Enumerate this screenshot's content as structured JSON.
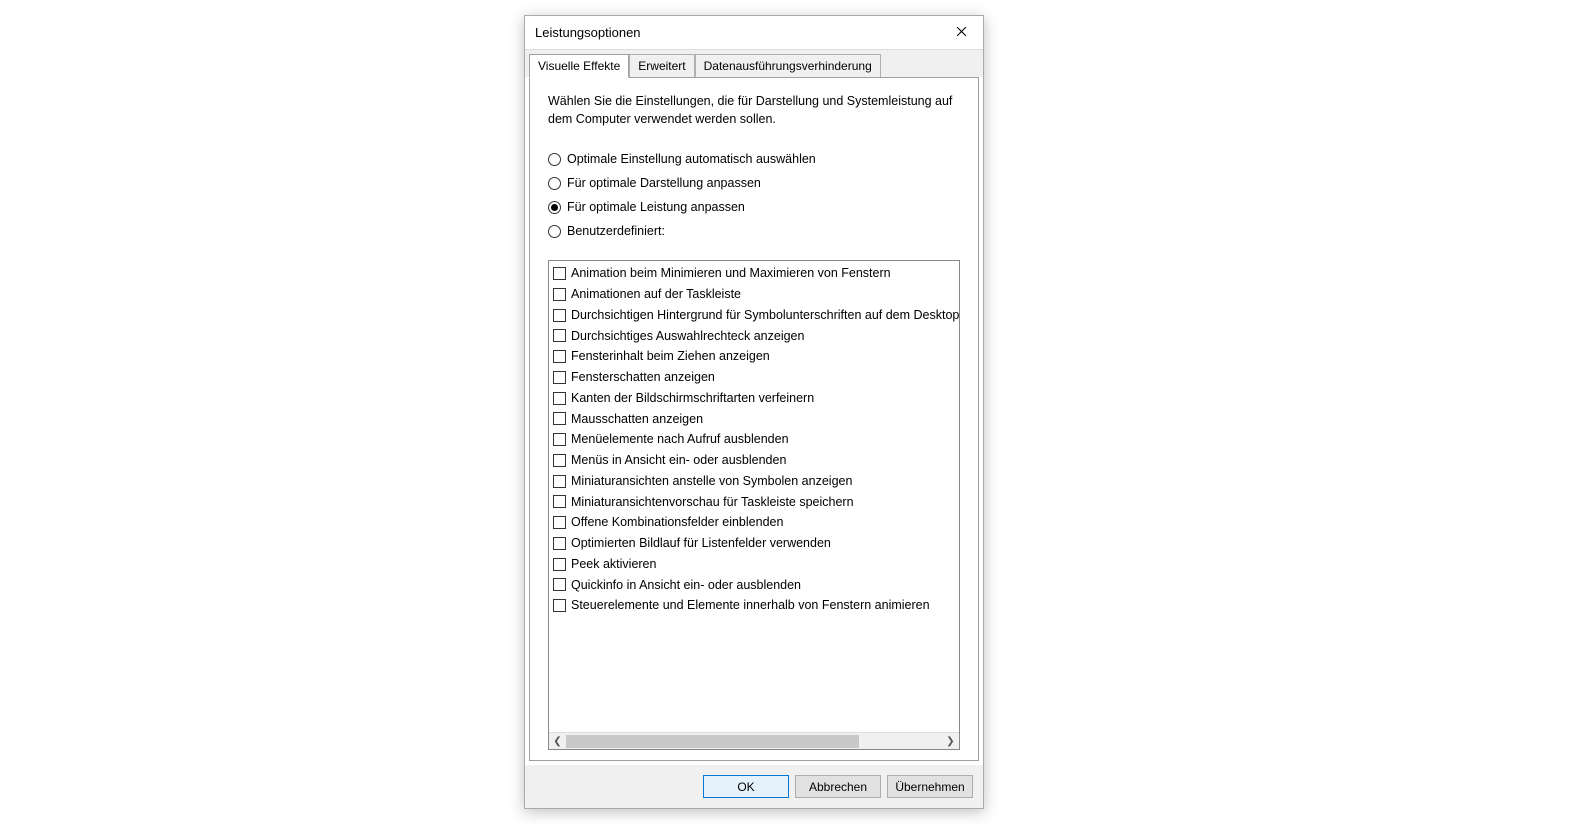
{
  "dialog": {
    "title": "Leistungsoptionen",
    "tabs": [
      {
        "label": "Visuelle Effekte",
        "active": true
      },
      {
        "label": "Erweitert",
        "active": false
      },
      {
        "label": "Datenausführungsverhinderung",
        "active": false
      }
    ],
    "description": "Wählen Sie die Einstellungen, die für Darstellung und Systemleistung auf dem Computer verwendet werden sollen.",
    "radios": [
      {
        "label": "Optimale Einstellung automatisch auswählen",
        "checked": false
      },
      {
        "label": "Für optimale Darstellung anpassen",
        "checked": false
      },
      {
        "label": "Für optimale Leistung anpassen",
        "checked": true
      },
      {
        "label": "Benutzerdefiniert:",
        "checked": false
      }
    ],
    "options": [
      {
        "label": "Animation beim Minimieren und Maximieren von Fenstern",
        "checked": false
      },
      {
        "label": "Animationen auf der Taskleiste",
        "checked": false
      },
      {
        "label": "Durchsichtigen Hintergrund für Symbolunterschriften auf dem Desktop anzeigen",
        "checked": false
      },
      {
        "label": "Durchsichtiges Auswahlrechteck anzeigen",
        "checked": false
      },
      {
        "label": "Fensterinhalt beim Ziehen anzeigen",
        "checked": false
      },
      {
        "label": "Fensterschatten anzeigen",
        "checked": false
      },
      {
        "label": "Kanten der Bildschirmschriftarten verfeinern",
        "checked": false
      },
      {
        "label": "Mausschatten anzeigen",
        "checked": false
      },
      {
        "label": "Menüelemente nach Aufruf ausblenden",
        "checked": false
      },
      {
        "label": "Menüs in Ansicht ein- oder ausblenden",
        "checked": false
      },
      {
        "label": "Miniaturansichten anstelle von Symbolen anzeigen",
        "checked": false
      },
      {
        "label": "Miniaturansichtenvorschau für Taskleiste speichern",
        "checked": false
      },
      {
        "label": "Offene Kombinationsfelder einblenden",
        "checked": false
      },
      {
        "label": "Optimierten Bildlauf für Listenfelder verwenden",
        "checked": false
      },
      {
        "label": "Peek aktivieren",
        "checked": false
      },
      {
        "label": "Quickinfo in Ansicht ein- oder ausblenden",
        "checked": false
      },
      {
        "label": "Steuerelemente und Elemente innerhalb von Fenstern animieren",
        "checked": false
      }
    ],
    "buttons": {
      "ok": "OK",
      "cancel": "Abbrechen",
      "apply": "Übernehmen"
    }
  }
}
